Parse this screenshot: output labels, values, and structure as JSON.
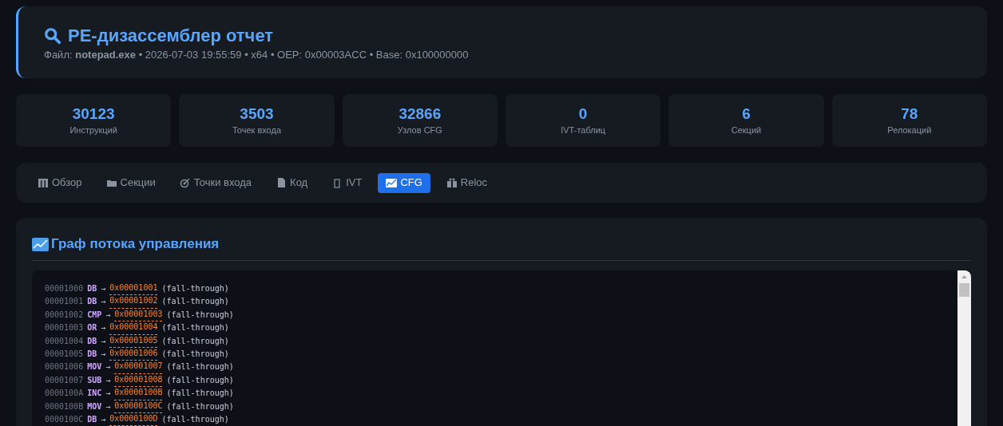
{
  "header": {
    "title": "PE-дизассемблер отчет",
    "meta": "Файл: **notepad.exe** • 2026-07-03 19:55:59 • x64 • OEP: 0x00003ACC • Base: 0x100000000"
  },
  "stats": [
    {
      "value": "30123",
      "label": "Инструкций"
    },
    {
      "value": "3503",
      "label": "Точек входа"
    },
    {
      "value": "32866",
      "label": "Узлов CFG"
    },
    {
      "value": "0",
      "label": "IVT-таблиц"
    },
    {
      "value": "6",
      "label": "Секций"
    },
    {
      "value": "78",
      "label": "Релокаций"
    }
  ],
  "tabs": [
    {
      "label": "Обзор",
      "kind": "overview",
      "selected": false
    },
    {
      "label": "Секции",
      "kind": "sections",
      "selected": false
    },
    {
      "label": "Точки входа",
      "kind": "entry",
      "selected": false
    },
    {
      "label": "Код",
      "kind": "code",
      "selected": false
    },
    {
      "label": "IVT",
      "kind": "ivt",
      "selected": false
    },
    {
      "label": "CFG",
      "kind": "cfg",
      "selected": true
    },
    {
      "label": "Reloc",
      "kind": "reloc",
      "selected": false
    }
  ],
  "section": {
    "title": "Граф потока управления",
    "edges": [
      {
        "address": "00001000",
        "mnemonic": "DB",
        "arrow": "→",
        "target": "0x00001001",
        "note": "(fall-through)"
      },
      {
        "address": "00001001",
        "mnemonic": "DB",
        "arrow": "→",
        "target": "0x00001002",
        "note": "(fall-through)"
      },
      {
        "address": "00001002",
        "mnemonic": "CMP",
        "arrow": "→",
        "target": "0x00001003",
        "note": "(fall-through)"
      },
      {
        "address": "00001003",
        "mnemonic": "OR",
        "arrow": "→",
        "target": "0x00001004",
        "note": "(fall-through)"
      },
      {
        "address": "00001004",
        "mnemonic": "DB",
        "arrow": "→",
        "target": "0x00001005",
        "note": "(fall-through)"
      },
      {
        "address": "00001005",
        "mnemonic": "DB",
        "arrow": "→",
        "target": "0x00001006",
        "note": "(fall-through)"
      },
      {
        "address": "00001006",
        "mnemonic": "MOV",
        "arrow": "→",
        "target": "0x00001007",
        "note": "(fall-through)"
      },
      {
        "address": "00001007",
        "mnemonic": "SUB",
        "arrow": "→",
        "target": "0x00001008",
        "note": "(fall-through)"
      },
      {
        "address": "0000100A",
        "mnemonic": "INC",
        "arrow": "→",
        "target": "0x0000100B",
        "note": "(fall-through)"
      },
      {
        "address": "0000100B",
        "mnemonic": "MOV",
        "arrow": "→",
        "target": "0x0000100C",
        "note": "(fall-through)"
      },
      {
        "address": "0000100C",
        "mnemonic": "DB",
        "arrow": "→",
        "target": "0x0000100D",
        "note": "(fall-through)"
      }
    ]
  }
}
